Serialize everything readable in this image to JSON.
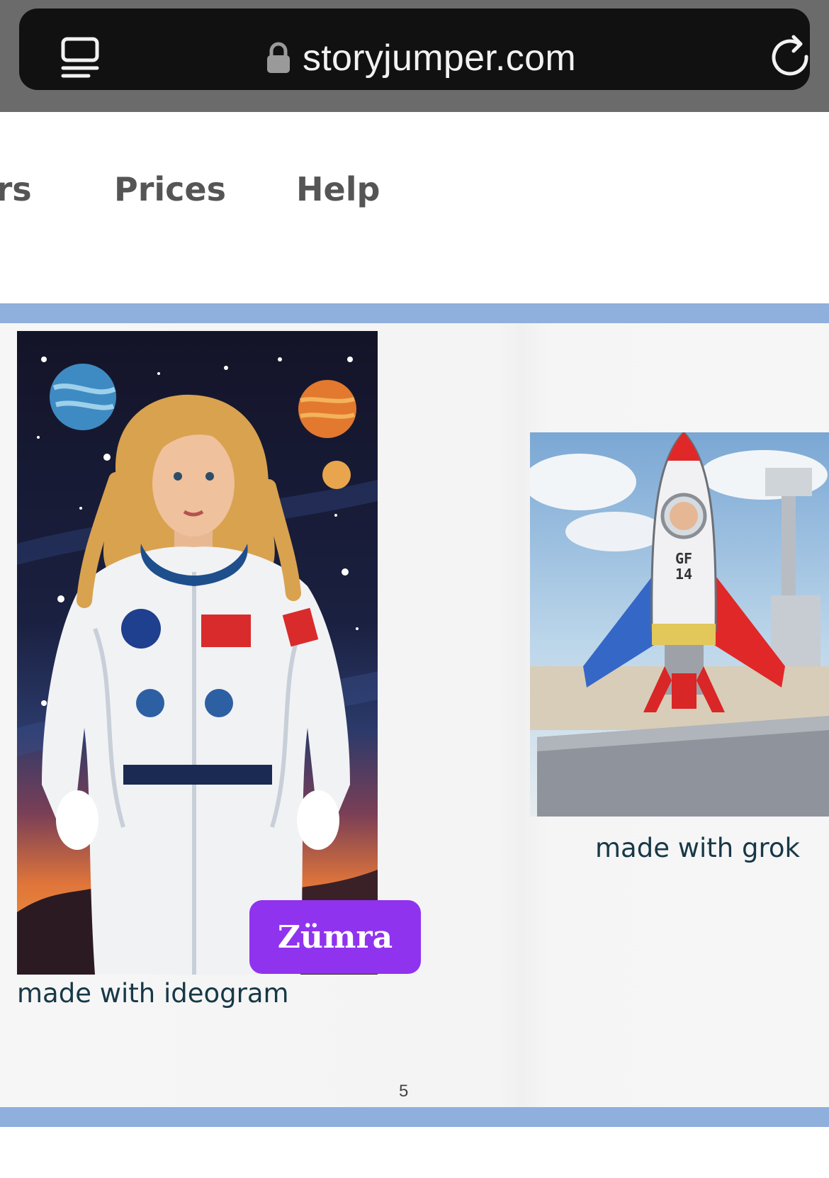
{
  "browser": {
    "url": "storyjumper.com",
    "icons": [
      "tabs-icon",
      "lock-icon",
      "reload-icon"
    ]
  },
  "nav": {
    "items": [
      {
        "label": "ors"
      },
      {
        "label": "Prices"
      },
      {
        "label": "Help"
      }
    ]
  },
  "book": {
    "left_image": {
      "icon": "astronaut-illustration",
      "caption": "made with ideogram",
      "name_badge": "Zümra"
    },
    "right_image": {
      "icon": "rocket-illustration",
      "rocket_text": "GF\n14",
      "caption": "made with grok"
    },
    "page_number": "5"
  },
  "colors": {
    "chrome": "#6b6b6b",
    "urlbar": "#111111",
    "nav_text": "#555555",
    "band": "#8fafdc",
    "badge": "#9033ee",
    "caption": "#173847"
  }
}
